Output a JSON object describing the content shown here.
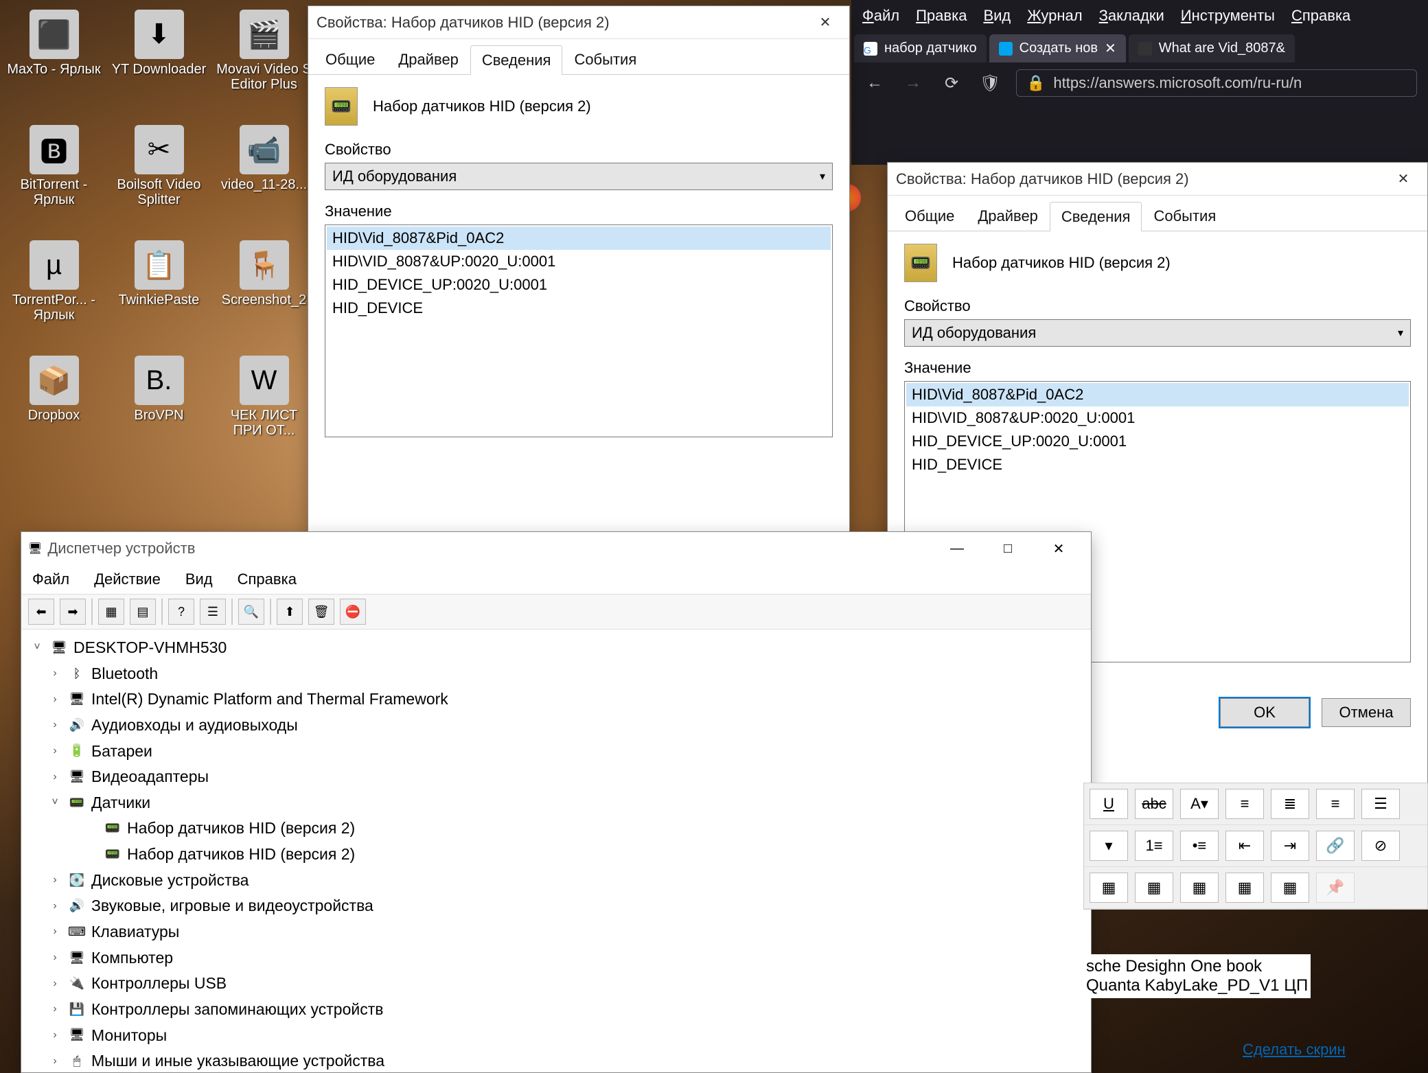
{
  "desktop": {
    "icons": [
      {
        "label": "MaxTo - Ярлык",
        "emoji": "⬛"
      },
      {
        "label": "YT Downloader",
        "emoji": "⬇"
      },
      {
        "label": "Movavi Video S Editor Plus",
        "emoji": "🎬"
      },
      {
        "label": "BitTorrent - Ярлык",
        "emoji": "🅱"
      },
      {
        "label": "Boilsoft Video Splitter",
        "emoji": "✂"
      },
      {
        "label": "video_11-28...",
        "emoji": "📹"
      },
      {
        "label": "TorrentPor... - Ярлык",
        "emoji": "µ"
      },
      {
        "label": "TwinkiePaste",
        "emoji": "📋"
      },
      {
        "label": "Screenshot_2",
        "emoji": "🪑"
      },
      {
        "label": "Dropbox",
        "emoji": "📦"
      },
      {
        "label": "BroVPN",
        "emoji": "B."
      },
      {
        "label": "ЧЕК ЛИСТ ПРИ ОТ...",
        "emoji": "W"
      }
    ]
  },
  "props1": {
    "title": "Свойства: Набор датчиков HID (версия 2)",
    "tabs": [
      "Общие",
      "Драйвер",
      "Сведения",
      "События"
    ],
    "active_tab": 2,
    "device_name": "Набор датчиков HID (версия 2)",
    "property_label": "Свойство",
    "property_value": "ИД оборудования",
    "value_label": "Значение",
    "values": [
      "HID\\Vid_8087&Pid_0AC2",
      "HID\\VID_8087&UP:0020_U:0001",
      "HID_DEVICE_UP:0020_U:0001",
      "HID_DEVICE"
    ]
  },
  "props2": {
    "title": "Свойства: Набор датчиков HID (версия 2)",
    "tabs": [
      "Общие",
      "Драйвер",
      "Сведения",
      "События"
    ],
    "active_tab": 2,
    "device_name": "Набор датчиков HID (версия 2)",
    "property_label": "Свойство",
    "property_value": "ИД оборудования",
    "value_label": "Значение",
    "values": [
      "HID\\Vid_8087&Pid_0AC2",
      "HID\\VID_8087&UP:0020_U:0001",
      "HID_DEVICE_UP:0020_U:0001",
      "HID_DEVICE"
    ],
    "ok": "OK",
    "cancel": "Отмена"
  },
  "firefox": {
    "menu": [
      "Файл",
      "Правка",
      "Вид",
      "Журнал",
      "Закладки",
      "Инструменты",
      "Справка"
    ],
    "tabs": [
      {
        "label": "набор датчико",
        "icon_bg": "#fff"
      },
      {
        "label": "Создать нов",
        "icon_bg": "#00a4ef",
        "active": true
      },
      {
        "label": "What are Vid_8087&",
        "icon_bg": "#333"
      }
    ],
    "url": "https://answers.microsoft.com/ru-ru/n"
  },
  "devmgr": {
    "title": "Диспетчер устройств",
    "menu": [
      "Файл",
      "Действие",
      "Вид",
      "Справка"
    ],
    "root": "DESKTOP-VHMH530",
    "nodes": [
      {
        "label": "Bluetooth",
        "icon": "ᛒ",
        "expandable": true
      },
      {
        "label": "Intel(R) Dynamic Platform and Thermal Framework",
        "icon": "🖥",
        "expandable": true
      },
      {
        "label": "Аудиовходы и аудиовыходы",
        "icon": "🔊",
        "expandable": true
      },
      {
        "label": "Батареи",
        "icon": "🔋",
        "expandable": true
      },
      {
        "label": "Видеоадаптеры",
        "icon": "🖥",
        "expandable": true
      },
      {
        "label": "Датчики",
        "icon": "📟",
        "expandable": true,
        "expanded": true,
        "children": [
          {
            "label": "Набор датчиков HID (версия 2)",
            "icon": "📟"
          },
          {
            "label": "Набор датчиков HID (версия 2)",
            "icon": "📟"
          }
        ]
      },
      {
        "label": "Дисковые устройства",
        "icon": "💽",
        "expandable": true
      },
      {
        "label": "Звуковые, игровые и видеоустройства",
        "icon": "🔊",
        "expandable": true
      },
      {
        "label": "Клавиатуры",
        "icon": "⌨",
        "expandable": true
      },
      {
        "label": "Компьютер",
        "icon": "🖥",
        "expandable": true
      },
      {
        "label": "Контроллеры USB",
        "icon": "🔌",
        "expandable": true
      },
      {
        "label": "Контроллеры запоминающих устройств",
        "icon": "💾",
        "expandable": true
      },
      {
        "label": "Мониторы",
        "icon": "🖥",
        "expandable": true
      },
      {
        "label": "Мыши и иные указывающие устройства",
        "icon": "🖱",
        "expandable": true
      }
    ]
  },
  "editor": {
    "text1": "sche Desighn One book",
    "text2": "Quanta KabyLake_PD_V1 ЦП",
    "link": "Сделать скрин"
  }
}
